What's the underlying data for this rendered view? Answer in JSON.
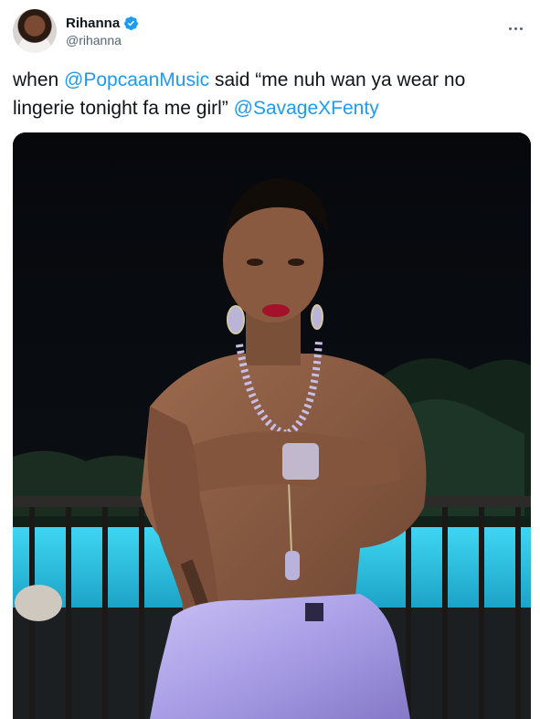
{
  "author": {
    "display_name": "Rihanna",
    "handle": "@rihanna",
    "verified": true,
    "avatar_icon": "profile-avatar"
  },
  "menu": {
    "icon": "more-horizontal-icon"
  },
  "tweet": {
    "text_parts": [
      {
        "text": "when ",
        "type": "text"
      },
      {
        "text": "@PopcaanMusic",
        "type": "mention"
      },
      {
        "text": " said “me nuh wan ya wear no lingerie tonight fa me girl” ",
        "type": "text"
      },
      {
        "text": "@SavageXFenty",
        "type": "mention"
      }
    ]
  },
  "colors": {
    "link": "#1d9bf0",
    "text": "#0f1419",
    "secondary": "#536471",
    "verified": "#1d9bf0",
    "pool": "#29c8e8",
    "satin": "#a99ee6"
  }
}
